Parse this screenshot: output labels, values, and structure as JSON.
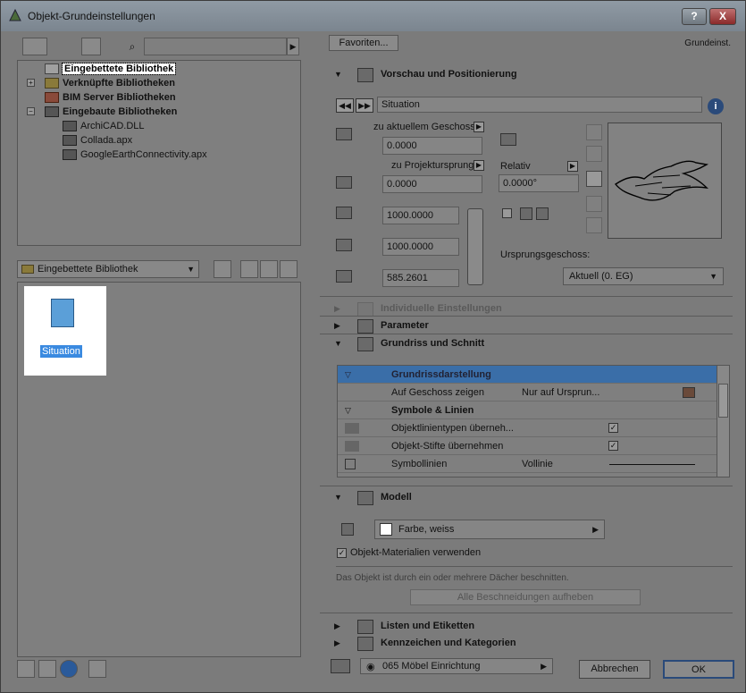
{
  "window": {
    "title": "Objekt-Grundeinstellungen",
    "help_label": "?",
    "close_label": "X"
  },
  "tree": {
    "items": [
      {
        "label": "Eingebettete Bibliothek",
        "bold": true,
        "selected": true
      },
      {
        "label": "Verknüpfte Bibliotheken",
        "bold": true
      },
      {
        "label": "BIM Server Bibliotheken",
        "bold": true
      },
      {
        "label": "Eingebaute Bibliotheken",
        "bold": true
      },
      {
        "label": "ArchiCAD.DLL"
      },
      {
        "label": "Collada.apx"
      },
      {
        "label": "GoogleEarthConnectivity.apx"
      }
    ]
  },
  "library_select": {
    "value": "Eingebettete Bibliothek"
  },
  "item": {
    "label": "Situation"
  },
  "right": {
    "favorites_label": "Favoriten...",
    "top_right_label": "Grundeinst.",
    "sections": {
      "preview": "Vorschau und Positionierung",
      "individual": "Individuelle Einstellungen",
      "parameters": "Parameter",
      "floorplan": "Grundriss und Schnitt",
      "model": "Modell",
      "lists": "Listen und Etiketten",
      "ids": "Kennzeichen und Kategorien"
    },
    "object_name": "Situation",
    "positioning": {
      "story_label": "zu aktuellem Geschoss",
      "story_value": "0.0000",
      "origin_label": "zu Projektursprung",
      "origin_value": "0.0000",
      "width": "1000.0000",
      "depth": "1000.0000",
      "height": "585.2601",
      "relative_label": "Relativ",
      "angle": "0.0000°",
      "home_story_label": "Ursprungsgeschoss:",
      "home_story_value": "Aktuell (0. EG)"
    },
    "floorplan_table": {
      "header": "Grundrissdarstellung",
      "rows": [
        {
          "name": "Auf Geschoss zeigen",
          "value": "Nur auf Ursprun..."
        },
        {
          "name": "Symbole & Linien",
          "value": ""
        },
        {
          "name": "Objektlinientypen überneh...",
          "value": "✓"
        },
        {
          "name": "Objekt-Stifte übernehmen",
          "value": "✓"
        },
        {
          "name": "Symbollinien",
          "value": "Vollinie"
        }
      ]
    },
    "model": {
      "surface": "Farbe, weiss",
      "use_materials_label": "Objekt-Materialien verwenden",
      "note": "Das Objekt ist durch ein oder mehrere Dächer beschnitten.",
      "remove_trims_label": "Alle Beschneidungen aufheben"
    },
    "layer": "065 Möbel Einrichtung",
    "cancel_label": "Abbrechen",
    "ok_label": "OK"
  }
}
